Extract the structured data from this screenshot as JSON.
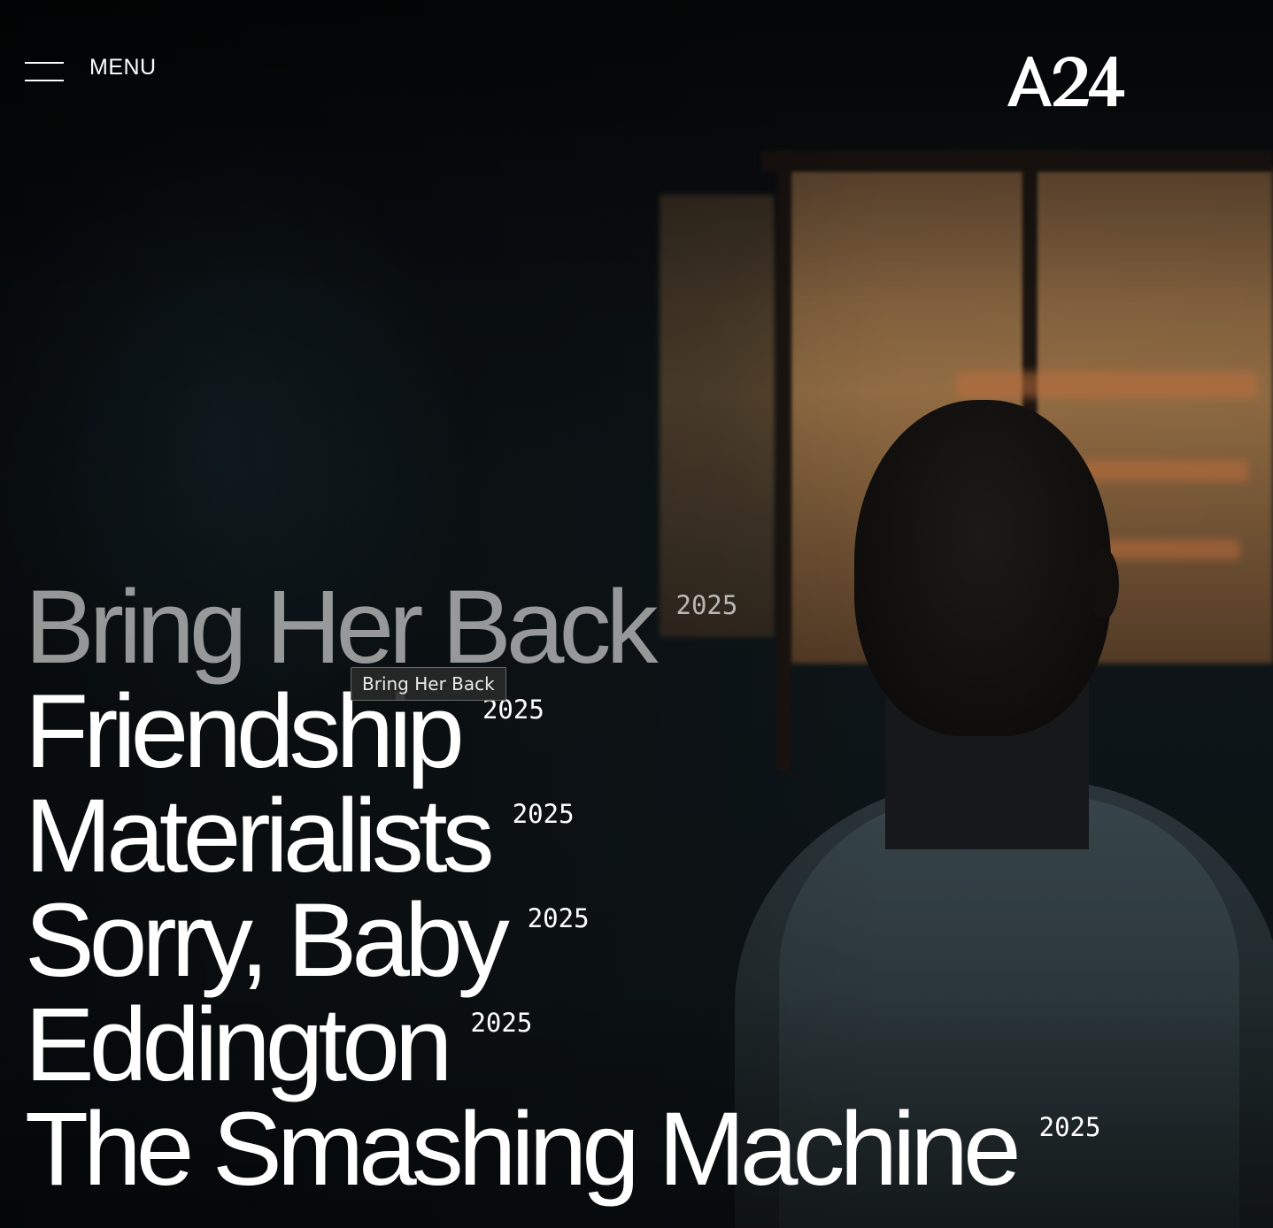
{
  "header": {
    "menu_label": "MENU",
    "logo_text": "A24"
  },
  "films": [
    {
      "title": "Bring Her Back",
      "year": "2025",
      "active": true
    },
    {
      "title": "Friendship",
      "year": "2025"
    },
    {
      "title": "Materialists",
      "year": "2025"
    },
    {
      "title": "Sorry, Baby",
      "year": "2025"
    },
    {
      "title": "Eddington",
      "year": "2025"
    },
    {
      "title": "The Smashing Machine",
      "year": "2025"
    }
  ],
  "tooltip": {
    "text": "Bring Her Back"
  },
  "icons": {
    "menu": "hamburger-icon"
  },
  "colors": {
    "text": "#ffffff",
    "active_title": "#cdcdcd",
    "tooltip_bg": "#282828"
  }
}
